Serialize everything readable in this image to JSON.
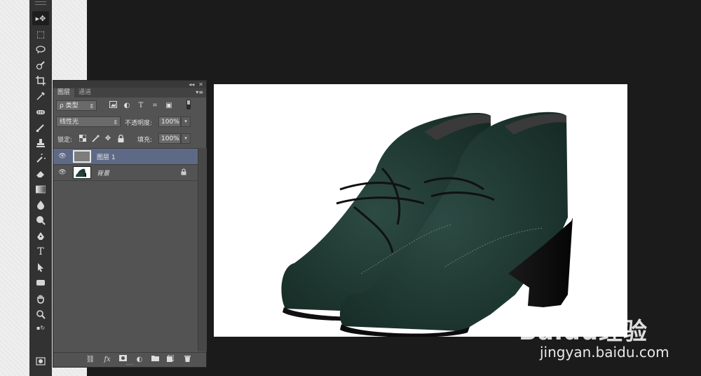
{
  "tools": [
    {
      "icon": "move-tool-icon",
      "glyph": "▸✥"
    },
    {
      "icon": "marquee-tool-icon",
      "glyph": "⬚"
    },
    {
      "icon": "lasso-tool-icon",
      "glyph": "ℓ"
    },
    {
      "icon": "quick-selection-icon",
      "glyph": "✎"
    },
    {
      "icon": "crop-tool-icon",
      "glyph": "⌗"
    },
    {
      "icon": "eyedropper-icon",
      "glyph": "✒"
    },
    {
      "icon": "healing-brush-icon",
      "glyph": "✚"
    },
    {
      "icon": "brush-tool-icon",
      "glyph": "/"
    },
    {
      "icon": "stamp-tool-icon",
      "glyph": "⊥"
    },
    {
      "icon": "history-brush-icon",
      "glyph": "↺"
    },
    {
      "icon": "eraser-tool-icon",
      "glyph": "▰"
    },
    {
      "icon": "gradient-tool-icon",
      "glyph": "▤"
    },
    {
      "icon": "blur-tool-icon",
      "glyph": "◆"
    },
    {
      "icon": "dodge-tool-icon",
      "glyph": "●"
    },
    {
      "icon": "pen-tool-icon",
      "glyph": "✑"
    },
    {
      "icon": "type-tool-icon",
      "glyph": "T"
    },
    {
      "icon": "path-selection-icon",
      "glyph": "▲"
    },
    {
      "icon": "shape-tool-icon",
      "glyph": "▬"
    },
    {
      "icon": "hand-tool-icon",
      "glyph": "✋"
    },
    {
      "icon": "zoom-tool-icon",
      "glyph": "🔍"
    }
  ],
  "panel": {
    "tabs": [
      "图层",
      "通道"
    ],
    "filter_label": "ρ 类型",
    "blend_mode": "线性光",
    "opacity_label": "不透明度:",
    "opacity_value": "100%",
    "lock_label": "锁定:",
    "fill_label": "填充:",
    "fill_value": "100%",
    "layers": [
      {
        "name": "图层 1",
        "selected": true
      },
      {
        "name": "背景",
        "selected": false,
        "locked": true
      }
    ]
  },
  "canvas": {
    "background": "#ffffff",
    "subject": "green suede ankle boots"
  },
  "watermark": {
    "logo": "Baidu经验",
    "url": "jingyan.baidu.com"
  }
}
